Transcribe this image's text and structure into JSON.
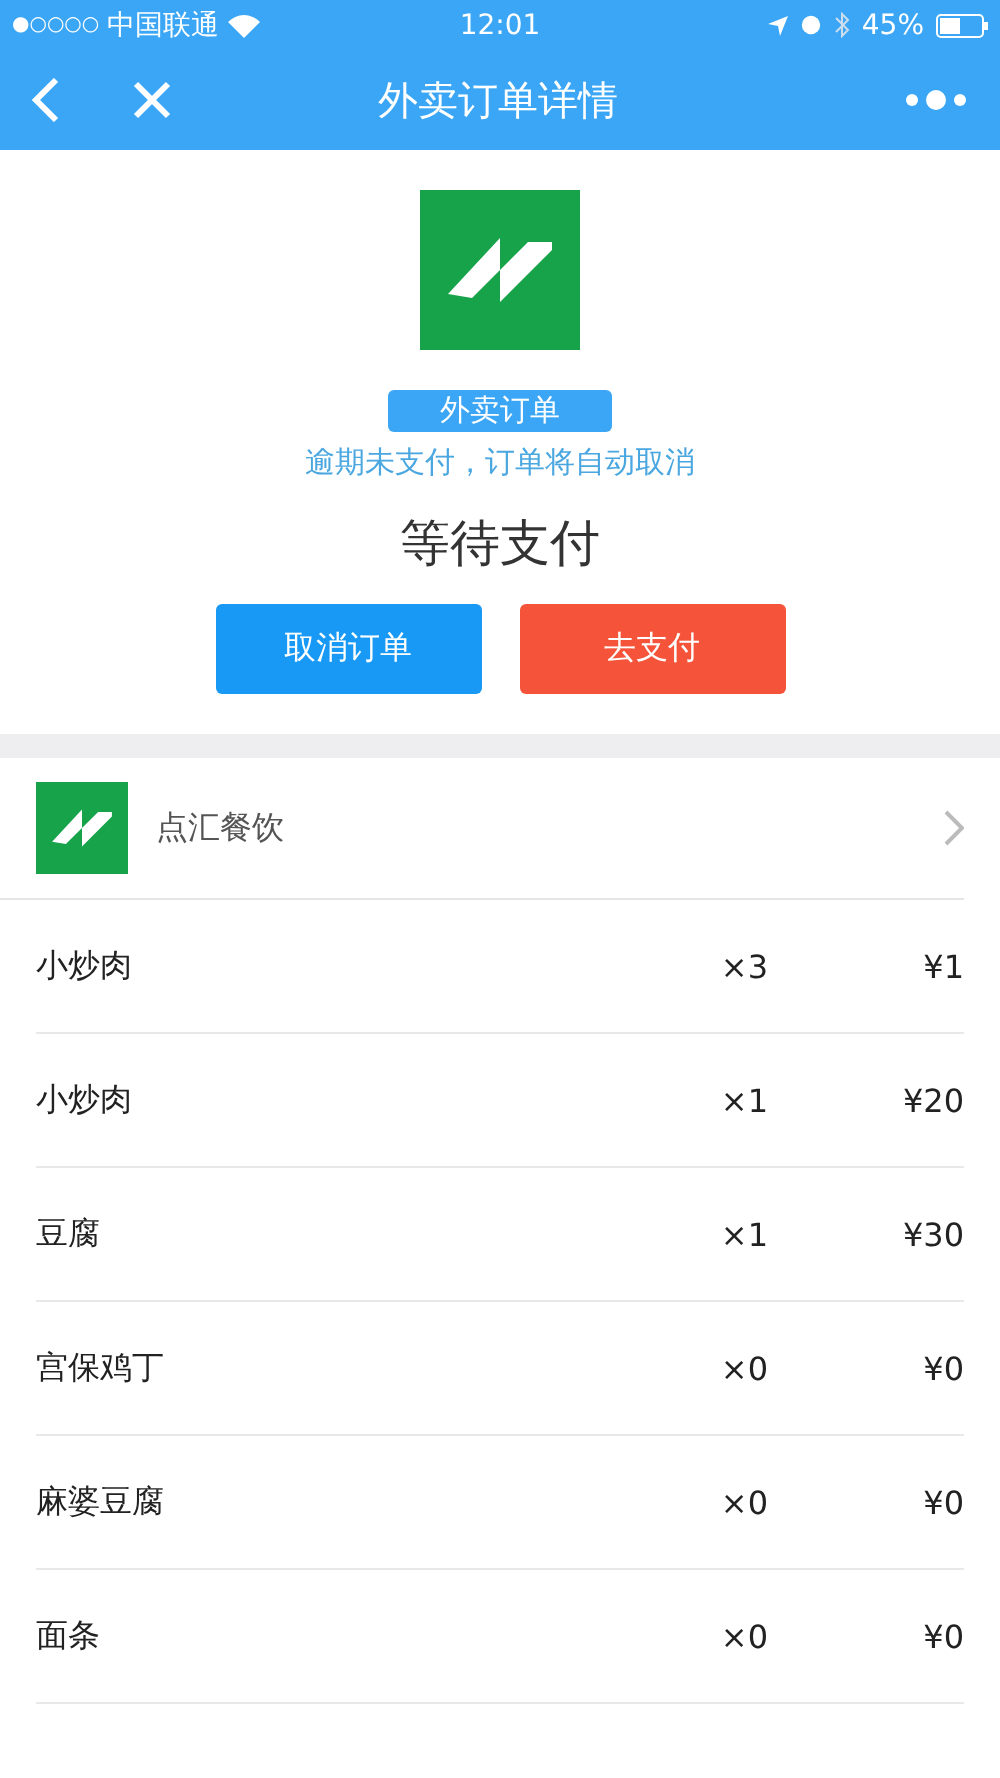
{
  "status_bar": {
    "signal": "●○○○○",
    "carrier": "中国联通",
    "time": "12:01",
    "battery": "45%"
  },
  "nav": {
    "title": "外卖订单详情"
  },
  "order": {
    "badge": "外卖订单",
    "notice": "逾期未支付，订单将自动取消",
    "status": "等待支付"
  },
  "buttons": [
    {
      "label": "取消订单",
      "kind": "cancel"
    },
    {
      "label": "去支付",
      "kind": "pay"
    }
  ],
  "shop": {
    "name": "点汇餐饮"
  },
  "items": [
    {
      "name": "小炒肉",
      "qty": "×3",
      "price": "¥1"
    },
    {
      "name": "小炒肉",
      "qty": "×1",
      "price": "¥20"
    },
    {
      "name": "豆腐",
      "qty": "×1",
      "price": "¥30"
    },
    {
      "name": "宫保鸡丁",
      "qty": "×0",
      "price": "¥0"
    },
    {
      "name": "麻婆豆腐",
      "qty": "×0",
      "price": "¥0"
    },
    {
      "name": "面条",
      "qty": "×0",
      "price": "¥0"
    }
  ]
}
